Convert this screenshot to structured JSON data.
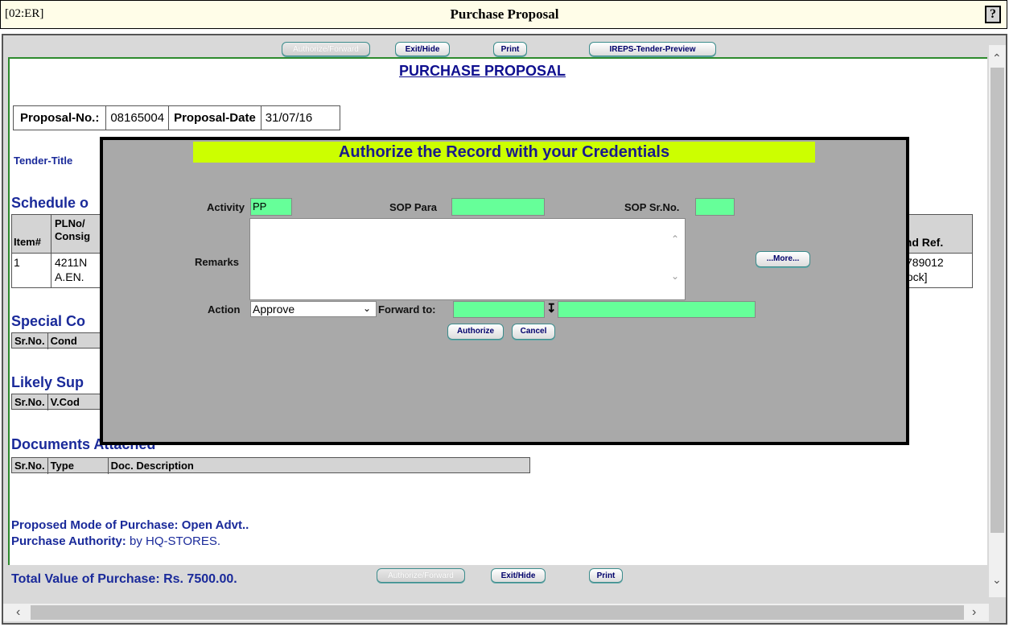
{
  "titlebar": {
    "code": "[02:ER]",
    "title": "Purchase Proposal",
    "help_icon": "question-icon",
    "help_label": "?"
  },
  "top_buttons": {
    "authorize": "Authorize/Forward",
    "exit": "Exit/Hide",
    "print": "Print",
    "ireps": "IREPS-Tender-Preview"
  },
  "main": {
    "heading": "PURCHASE PROPOSAL",
    "proposal_no_label": "Proposal-No.:",
    "proposal_no": "08165004",
    "proposal_date_label": "Proposal-Date",
    "proposal_date": "31/07/16",
    "tender_title_label": "Tender-Title",
    "schedule_heading": "Schedule o",
    "schedule_cols": {
      "item": "Item#",
      "plno_line1": "PLNo/",
      "plno_line2": "Consig",
      "brand": "and Ref."
    },
    "schedule_row": {
      "item": "1",
      "plno_line1": "4211N",
      "plno_line2": "A.EN.",
      "brand_line1": "789012",
      "brand_line2": "tock]"
    },
    "special_heading": "Special Co",
    "special_cols": [
      "Sr.No.",
      "Cond"
    ],
    "likely_heading": "Likely Sup",
    "likely_cols": [
      "Sr.No.",
      "V.Cod"
    ],
    "docs_heading": "Documents Attached",
    "docs_cols": [
      "Sr.No.",
      "Type",
      "Doc. Description"
    ],
    "mode_label": "Proposed Mode of Purchase:",
    "mode_value": "Open Advt..",
    "authority_label": "Purchase Authority:",
    "authority_value": "by HQ-STORES.",
    "total_label": "Total Value of Purchase: Rs. 7500.00."
  },
  "bottom_buttons": {
    "authorize": "Authorize/Forward",
    "exit": "Exit/Hide",
    "print": "Print"
  },
  "modal": {
    "title": "Authorize the Record with your Credentials",
    "activity_label": "Activity",
    "activity_value": "PP",
    "sop_para_label": "SOP Para",
    "sop_para_value": "",
    "sop_srno_label": "SOP Sr.No.",
    "sop_srno_value": "",
    "remarks_label": "Remarks",
    "more_button": "...More...",
    "action_label": "Action",
    "action_value": "Approve",
    "forward_label": "Forward to:",
    "forward_value": "",
    "forward_name_value": "",
    "authorize_button": "Authorize",
    "cancel_button": "Cancel"
  },
  "colors": {
    "modal_title_bg": "#ccff00",
    "green_input": "#66ff99",
    "heading_blue": "#1a2a9a",
    "frame_green": "#2d8a2d"
  }
}
